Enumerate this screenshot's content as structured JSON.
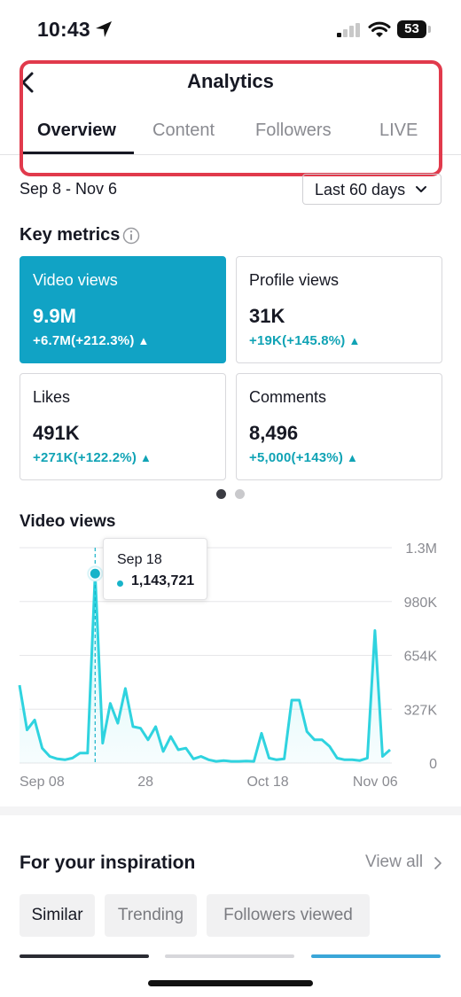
{
  "status_bar": {
    "time": "10:43",
    "battery": "53"
  },
  "header": {
    "title": "Analytics",
    "tabs": [
      {
        "label": "Overview",
        "active": true
      },
      {
        "label": "Content",
        "active": false
      },
      {
        "label": "Followers",
        "active": false
      },
      {
        "label": "LIVE",
        "active": false
      }
    ]
  },
  "date_row": {
    "range": "Sep 8 - Nov 6",
    "period_label": "Last 60 days"
  },
  "key_metrics": {
    "title": "Key metrics",
    "cards": [
      {
        "label": "Video views",
        "value": "9.9M",
        "change": "+6.7M(+212.3%)",
        "selected": true
      },
      {
        "label": "Profile views",
        "value": "31K",
        "change": "+19K(+145.8%)",
        "selected": false
      },
      {
        "label": "Likes",
        "value": "491K",
        "change": "+271K(+122.2%)",
        "selected": false
      },
      {
        "label": "Comments",
        "value": "8,496",
        "change": "+5,000(+143%)",
        "selected": false
      }
    ],
    "page_indicator": {
      "pages": 2,
      "active_index": 0
    }
  },
  "video_views_chart": {
    "title": "Video views",
    "tooltip": {
      "date": "Sep 18",
      "value": "1,143,721"
    }
  },
  "chart_data": {
    "type": "area",
    "title": "Video views",
    "y_tick_labels": [
      "1.3M",
      "980K",
      "654K",
      "327K",
      "0"
    ],
    "x_tick_labels": [
      "Sep 08",
      "28",
      "Oct 18",
      "Nov 06"
    ],
    "ylim": [
      0,
      1300000
    ],
    "grid": true,
    "color": "#2fd3df",
    "highlight": {
      "x": "Sep 18",
      "y": 1143721
    },
    "series": [
      {
        "values": [
          470000,
          200000,
          260000,
          90000,
          40000,
          25000,
          20000,
          30000,
          60000,
          60000,
          1143721,
          120000,
          360000,
          240000,
          450000,
          220000,
          210000,
          140000,
          220000,
          70000,
          160000,
          80000,
          90000,
          25000,
          40000,
          20000,
          10000,
          15000,
          10000,
          10000,
          12000,
          10000,
          180000,
          30000,
          20000,
          25000,
          380000,
          380000,
          190000,
          140000,
          140000,
          100000,
          30000,
          20000,
          20000,
          15000,
          30000,
          800000,
          40000,
          80000
        ]
      }
    ]
  },
  "inspiration": {
    "title": "For your inspiration",
    "view_all": "View all",
    "chips": [
      {
        "label": "Similar",
        "active": true
      },
      {
        "label": "Trending",
        "active": false
      },
      {
        "label": "Followers viewed",
        "active": false
      }
    ]
  },
  "colors": {
    "accent": "#11a3c5",
    "highlight_border": "#e13a4c",
    "chart_line": "#2fd3df"
  }
}
